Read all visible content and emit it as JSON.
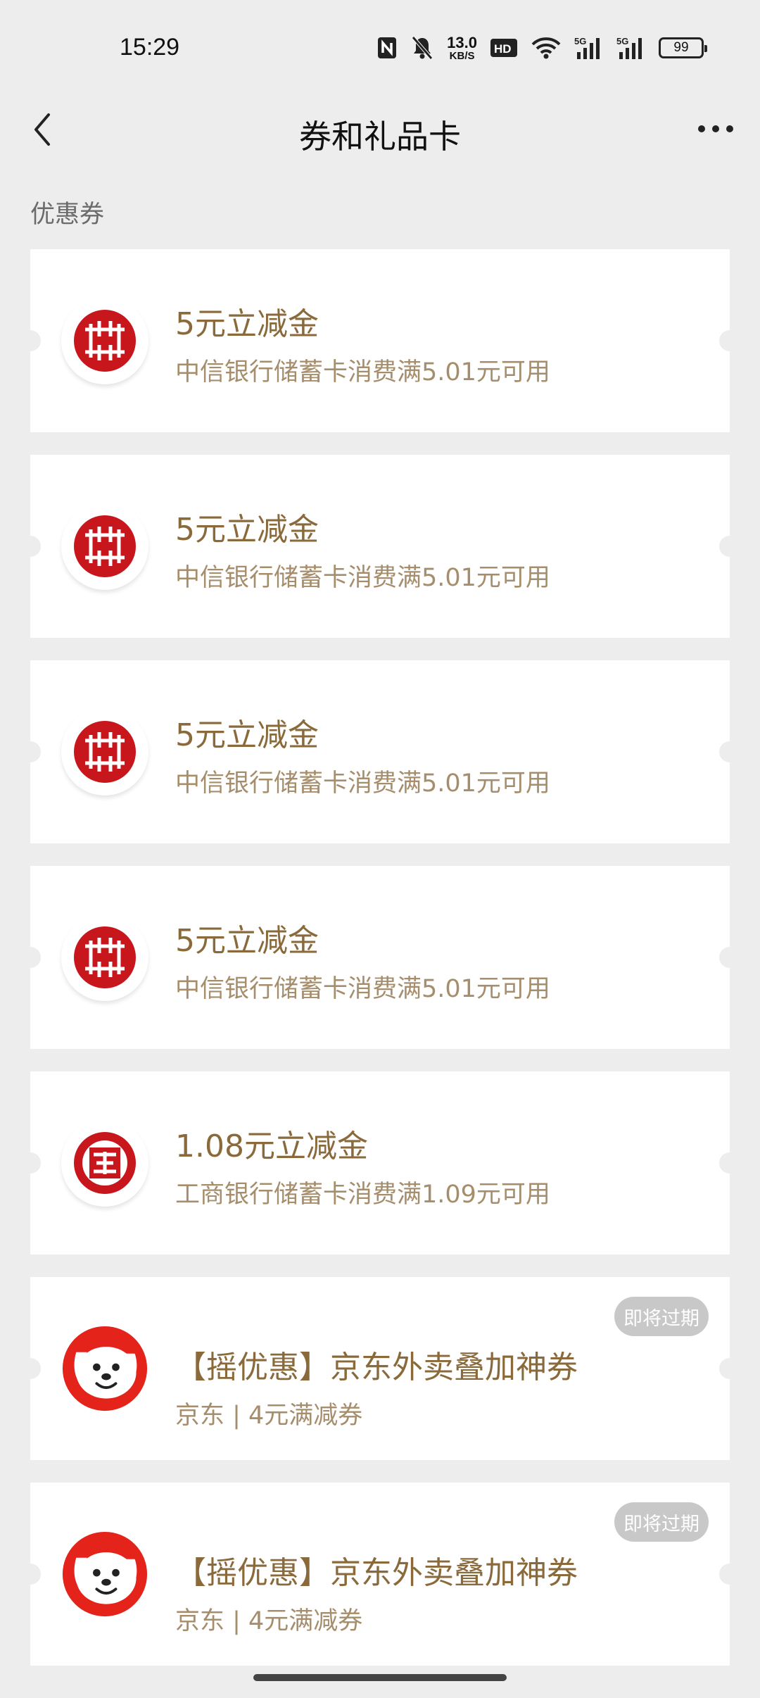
{
  "status_bar": {
    "time": "15:29",
    "net_speed_value": "13.0",
    "net_speed_unit": "KB/S",
    "battery": "99",
    "icons": [
      "nfc-icon",
      "mute-bell-icon",
      "hd-icon",
      "wifi-icon",
      "5g-signal-icon",
      "5g-signal-icon"
    ]
  },
  "header": {
    "title": "券和礼品卡",
    "back_icon": "chevron-left-icon",
    "more_icon": "more-dots-icon"
  },
  "section": {
    "title": "优惠券"
  },
  "coupons": [
    {
      "logo": "citic-bank-logo",
      "title": "5元立减金",
      "desc": "中信银行储蓄卡消费满5.01元可用"
    },
    {
      "logo": "citic-bank-logo",
      "title": "5元立减金",
      "desc": "中信银行储蓄卡消费满5.01元可用"
    },
    {
      "logo": "citic-bank-logo",
      "title": "5元立减金",
      "desc": "中信银行储蓄卡消费满5.01元可用"
    },
    {
      "logo": "citic-bank-logo",
      "title": "5元立减金",
      "desc": "中信银行储蓄卡消费满5.01元可用"
    },
    {
      "logo": "icbc-logo",
      "title": "1.08元立减金",
      "desc": "工商银行储蓄卡消费满1.09元可用"
    },
    {
      "logo": "jd-dog-logo",
      "title": "【摇优惠】京东外卖叠加神券",
      "desc": "京东 | 4元满减券",
      "badge": "即将过期"
    },
    {
      "logo": "jd-dog-logo",
      "title": "【摇优惠】京东外卖叠加神券",
      "desc": "京东 | 4元满减券",
      "badge": "即将过期"
    }
  ],
  "colors": {
    "background": "#ededed",
    "coupon_title": "#8a6a3b",
    "coupon_desc": "#a68e6c",
    "bank_red": "#c8161d",
    "jd_red": "#e4231b",
    "badge_bg": "#c8c8c8"
  }
}
